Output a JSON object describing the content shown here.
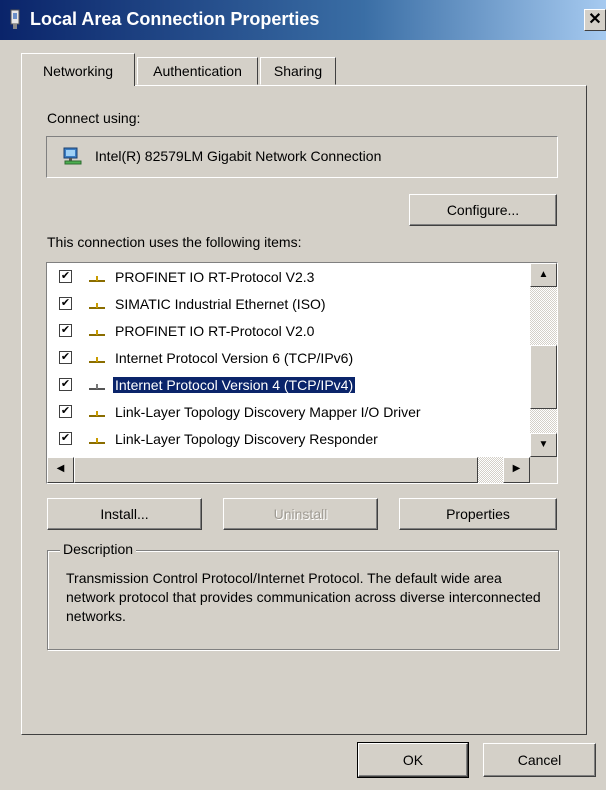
{
  "window": {
    "title": "Local Area Connection Properties",
    "close_label": "✕"
  },
  "tabs": [
    {
      "label": "Networking",
      "active": true
    },
    {
      "label": "Authentication",
      "active": false
    },
    {
      "label": "Sharing",
      "active": false
    }
  ],
  "connect_using": {
    "label": "Connect using:",
    "adapter": "Intel(R) 82579LM Gigabit Network Connection",
    "adapter_icon": "network-adapter-icon",
    "configure_label": "Configure..."
  },
  "items_label": "This connection uses the following items:",
  "items": [
    {
      "label": "PROFINET IO RT-Protocol V2.3",
      "checked": true,
      "selected": false
    },
    {
      "label": "SIMATIC Industrial Ethernet (ISO)",
      "checked": true,
      "selected": false
    },
    {
      "label": "PROFINET IO RT-Protocol V2.0",
      "checked": true,
      "selected": false
    },
    {
      "label": "Internet Protocol Version 6 (TCP/IPv6)",
      "checked": true,
      "selected": false
    },
    {
      "label": "Internet Protocol Version 4 (TCP/IPv4)",
      "checked": true,
      "selected": true
    },
    {
      "label": "Link-Layer Topology Discovery Mapper I/O Driver",
      "checked": true,
      "selected": false
    },
    {
      "label": "Link-Layer Topology Discovery Responder",
      "checked": true,
      "selected": false
    }
  ],
  "buttons": {
    "install": "Install...",
    "uninstall": "Uninstall",
    "properties": "Properties",
    "ok": "OK",
    "cancel": "Cancel"
  },
  "description": {
    "title": "Description",
    "text": "Transmission Control Protocol/Internet Protocol. The default wide area network protocol that provides communication across diverse interconnected networks."
  },
  "colors": {
    "titlebar": "#0a246a",
    "selection": "#0a246a",
    "face": "#d4d0c8"
  }
}
